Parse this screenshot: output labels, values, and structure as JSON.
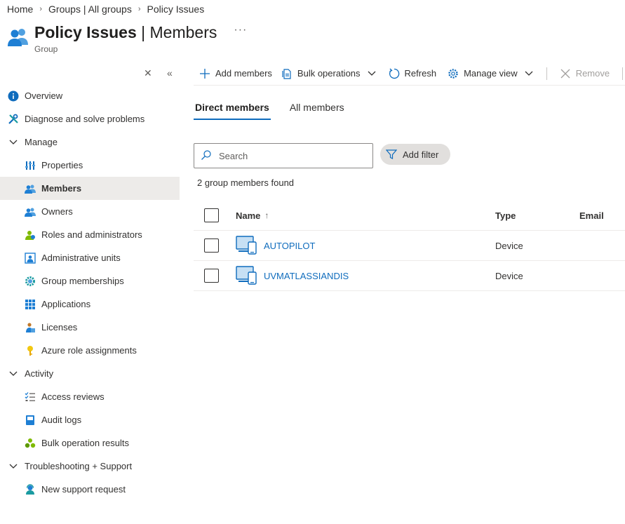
{
  "breadcrumb": [
    "Home",
    "Groups | All groups",
    "Policy Issues"
  ],
  "header": {
    "title_bold": "Policy Issues",
    "title_rest": " | Members",
    "subtitle": "Group",
    "more": "···"
  },
  "sidebar": {
    "close": "✕",
    "collapse": "«",
    "items": [
      {
        "label": "Overview",
        "icon": "info-icon"
      },
      {
        "label": "Diagnose and solve problems",
        "icon": "wrench-icon"
      },
      {
        "label": "Manage",
        "icon": "chevron-down-icon"
      },
      {
        "label": "Properties",
        "icon": "properties-icon"
      },
      {
        "label": "Members",
        "icon": "members-icon"
      },
      {
        "label": "Owners",
        "icon": "owners-icon"
      },
      {
        "label": "Roles and administrators",
        "icon": "roles-icon"
      },
      {
        "label": "Administrative units",
        "icon": "admin-units-icon"
      },
      {
        "label": "Group memberships",
        "icon": "gear-icon"
      },
      {
        "label": "Applications",
        "icon": "apps-grid-icon"
      },
      {
        "label": "Licenses",
        "icon": "license-icon"
      },
      {
        "label": "Azure role assignments",
        "icon": "key-icon"
      },
      {
        "label": "Activity",
        "icon": "chevron-down-icon"
      },
      {
        "label": "Access reviews",
        "icon": "checklist-icon"
      },
      {
        "label": "Audit logs",
        "icon": "book-icon"
      },
      {
        "label": "Bulk operation results",
        "icon": "bulk-icon"
      },
      {
        "label": "Troubleshooting + Support",
        "icon": "chevron-down-icon"
      },
      {
        "label": "New support request",
        "icon": "support-person-icon"
      }
    ]
  },
  "toolbar": {
    "add_members": "Add members",
    "bulk_operations": "Bulk operations",
    "refresh": "Refresh",
    "manage_view": "Manage view",
    "remove": "Remove"
  },
  "tabs": [
    "Direct members",
    "All members"
  ],
  "search": {
    "placeholder": "Search"
  },
  "filter": {
    "label": "Add filter"
  },
  "results": {
    "found_text": "2 group members found"
  },
  "table": {
    "columns": [
      "Name",
      "Type",
      "Email"
    ],
    "sort_indicator": "↑",
    "rows": [
      {
        "name": "AUTOPILOT",
        "type": "Device",
        "email": ""
      },
      {
        "name": "UVMATLASSIANDIS",
        "type": "Device",
        "email": ""
      }
    ]
  },
  "colors": {
    "accent": "#0f6cbd",
    "active_bg": "#edebe9"
  }
}
